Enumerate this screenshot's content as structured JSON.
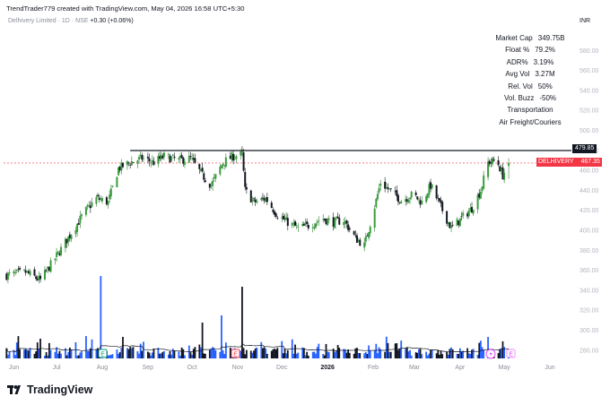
{
  "header": {
    "caption": "TrendTrader779 created with TradingView.com, May 04, 2026 16:58 UTC+5:30",
    "symbol_text": "Delhivery Limited · 1D · NSE",
    "change_text": "+0.30 (+0.06%)",
    "currency": "INR"
  },
  "stats": [
    {
      "label": "Market Cap",
      "value": "349.75B"
    },
    {
      "label": "Float %",
      "value": "79.2%"
    },
    {
      "label": "ADR%",
      "value": "3.19%"
    },
    {
      "label": "Avg Vol",
      "value": "3.27M"
    },
    {
      "label": "Rel. Vol",
      "value": "50%"
    },
    {
      "label": "Vol. Buzz",
      "value": "-50%"
    },
    {
      "label": "",
      "value": "Transportation"
    },
    {
      "label": "",
      "value": "Air Freight/Couriers"
    }
  ],
  "price_labels": {
    "level_value": "479.85",
    "symbol_name": "DELHIVERY",
    "symbol_value": "467.35"
  },
  "colors": {
    "up": "#089981",
    "down": "#131722",
    "up_body": "#2e7d32",
    "volume_up": "#2962ff",
    "volume_down": "#131722",
    "last_price_line": "#f23645",
    "level_line": "#131722"
  },
  "brand": {
    "name": "TradingView"
  },
  "icons": [
    "tradingview-logo-icon",
    "earnings-e-icon",
    "dividend-lightning-icon"
  ],
  "chart_data": {
    "type": "candlestick",
    "title": "",
    "xlabel": "",
    "ylabel": "",
    "ylim": [
      270,
      600
    ],
    "y_ticks": [
      280,
      300,
      320,
      340,
      360,
      380,
      400,
      420,
      440,
      460,
      480,
      500,
      520,
      540,
      560,
      580
    ],
    "x_ticks": [
      "Jun",
      "Jul",
      "Aug",
      "Sep",
      "Oct",
      "Nov",
      "Dec",
      "2026",
      "Feb",
      "Mar",
      "Apr",
      "May",
      "Jun"
    ],
    "horizontal_level": 479.85,
    "last_price": 467.35,
    "close_path": [
      {
        "x": "2025-05-28",
        "y": 355
      },
      {
        "x": "2025-06-10",
        "y": 358
      },
      {
        "x": "2025-06-20",
        "y": 350
      },
      {
        "x": "2025-06-30",
        "y": 372
      },
      {
        "x": "2025-07-10",
        "y": 395
      },
      {
        "x": "2025-07-20",
        "y": 418
      },
      {
        "x": "2025-07-28",
        "y": 432
      },
      {
        "x": "2025-08-05",
        "y": 428
      },
      {
        "x": "2025-08-12",
        "y": 462
      },
      {
        "x": "2025-08-20",
        "y": 468
      },
      {
        "x": "2025-08-28",
        "y": 472
      },
      {
        "x": "2025-09-05",
        "y": 468
      },
      {
        "x": "2025-09-12",
        "y": 474
      },
      {
        "x": "2025-09-22",
        "y": 470
      },
      {
        "x": "2025-09-30",
        "y": 472
      },
      {
        "x": "2025-10-08",
        "y": 455
      },
      {
        "x": "2025-10-14",
        "y": 445
      },
      {
        "x": "2025-10-22",
        "y": 468
      },
      {
        "x": "2025-10-29",
        "y": 474
      },
      {
        "x": "2025-11-04",
        "y": 476
      },
      {
        "x": "2025-11-06",
        "y": 440
      },
      {
        "x": "2025-11-12",
        "y": 428
      },
      {
        "x": "2025-11-20",
        "y": 432
      },
      {
        "x": "2025-11-28",
        "y": 415
      },
      {
        "x": "2025-12-05",
        "y": 408
      },
      {
        "x": "2025-12-12",
        "y": 402
      },
      {
        "x": "2025-12-20",
        "y": 405
      },
      {
        "x": "2025-12-28",
        "y": 412
      },
      {
        "x": "2026-01-05",
        "y": 408
      },
      {
        "x": "2026-01-12",
        "y": 410
      },
      {
        "x": "2026-01-20",
        "y": 392
      },
      {
        "x": "2026-01-26",
        "y": 385
      },
      {
        "x": "2026-02-01",
        "y": 418
      },
      {
        "x": "2026-02-06",
        "y": 448
      },
      {
        "x": "2026-02-12",
        "y": 440
      },
      {
        "x": "2026-02-20",
        "y": 430
      },
      {
        "x": "2026-02-28",
        "y": 436
      },
      {
        "x": "2026-03-06",
        "y": 428
      },
      {
        "x": "2026-03-12",
        "y": 445
      },
      {
        "x": "2026-03-20",
        "y": 420
      },
      {
        "x": "2026-03-26",
        "y": 402
      },
      {
        "x": "2026-04-02",
        "y": 412
      },
      {
        "x": "2026-04-09",
        "y": 422
      },
      {
        "x": "2026-04-15",
        "y": 440
      },
      {
        "x": "2026-04-20",
        "y": 468
      },
      {
        "x": "2026-04-26",
        "y": 470
      },
      {
        "x": "2026-04-30",
        "y": 455
      },
      {
        "x": "2026-05-04",
        "y": 467.35
      }
    ],
    "volume_spikes": [
      {
        "x": "2025-07-31",
        "note": "tall blue"
      },
      {
        "x": "2025-10-21",
        "note": "tall blue"
      },
      {
        "x": "2025-11-04",
        "note": "tallest black"
      },
      {
        "x": "2026-02-01",
        "note": "tall blue"
      }
    ],
    "series": [
      {
        "name": "DELHIVERY",
        "values": []
      }
    ]
  }
}
